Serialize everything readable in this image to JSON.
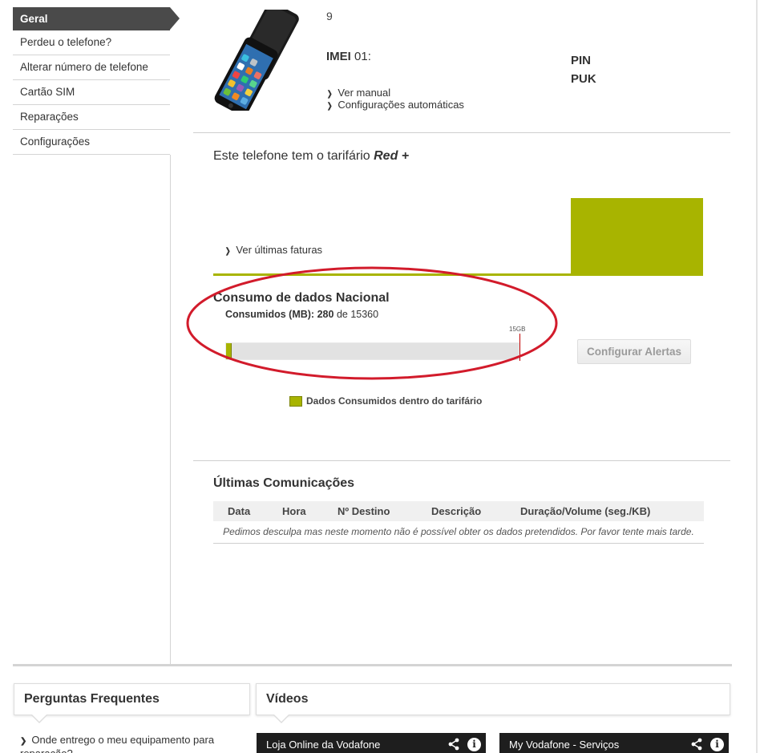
{
  "sidebar": {
    "items": [
      {
        "label": "Geral"
      },
      {
        "label": "Perdeu o telefone?"
      },
      {
        "label": "Alterar número de telefone"
      },
      {
        "label": "Cartão SIM"
      },
      {
        "label": "Reparações"
      },
      {
        "label": "Configurações"
      }
    ]
  },
  "device": {
    "phone_number": "9",
    "imei_label": "IMEI",
    "imei_value": "01:",
    "pin_label": "PIN",
    "puk_label": "PUK",
    "links": {
      "manual": "Ver manual",
      "auto_config": "Configurações automáticas"
    }
  },
  "tariff": {
    "prefix": "Este telefone tem o tarifário",
    "name": "Red +",
    "invoices_link": "Ver últimas faturas"
  },
  "consumption": {
    "title": "Consumo de dados Nacional",
    "consumed_label": "Consumidos (MB):",
    "consumed_value": "280",
    "of_word": "de",
    "total_value": "15360",
    "cap_label": "15GB",
    "used_fraction": 0.018,
    "alerts_button": "Configurar Alertas",
    "legend": "Dados Consumidos dentro do tarifário",
    "accent_color": "#a8b400",
    "marker_color": "#c00000"
  },
  "communications": {
    "title": "Últimas Comunicações",
    "columns": [
      "Data",
      "Hora",
      "Nº Destino",
      "Descrição",
      "Duração/Volume (seg./KB)"
    ],
    "empty_message": "Pedimos desculpa mas neste momento não é possível obter os dados pretendidos. Por favor tente mais tarde."
  },
  "faq": {
    "title": "Perguntas Frequentes",
    "question": "Onde entrego o meu equipamento para reparação?"
  },
  "videos": {
    "title": "Vídeos",
    "items": [
      {
        "title": "Loja Online da Vodafone",
        "icons": [
          "share-icon",
          "info-icon"
        ]
      },
      {
        "title": "My Vodafone - Serviços",
        "icons": [
          "share-icon",
          "info-icon"
        ]
      }
    ]
  }
}
